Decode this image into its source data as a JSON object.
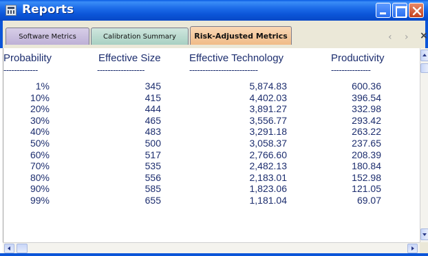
{
  "window": {
    "title": "Reports",
    "colors": {
      "titlebar": "#0b55d8",
      "text": "#1c2d6e",
      "close_button": "#c4401d"
    }
  },
  "tabs": [
    {
      "label": "Software Metrics",
      "active": false,
      "color": "#bdb0d6"
    },
    {
      "label": "Calibration Summary",
      "active": false,
      "color": "#a8d0c2"
    },
    {
      "label": "Risk-Adjusted Metrics",
      "active": true,
      "color": "#f0bb88"
    }
  ],
  "tab_nav": {
    "left_icon": "chevron-left-icon",
    "right_icon": "chevron-right-icon",
    "close_icon": "close-icon"
  },
  "table": {
    "columns": [
      "Probability",
      "Effective Size",
      "Effective Technology",
      "Productivity"
    ],
    "separators": [
      "-------------",
      "------------------",
      "--------------------------",
      "---------------"
    ],
    "rows": [
      [
        "1%",
        "345",
        "5,874.83",
        "600.36"
      ],
      [
        "10%",
        "415",
        "4,402.03",
        "396.54"
      ],
      [
        "20%",
        "444",
        "3,891.27",
        "332.98"
      ],
      [
        "30%",
        "465",
        "3,556.77",
        "293.42"
      ],
      [
        "40%",
        "483",
        "3,291.18",
        "263.22"
      ],
      [
        "50%",
        "500",
        "3,058.37",
        "237.65"
      ],
      [
        "60%",
        "517",
        "2,766.60",
        "208.39"
      ],
      [
        "70%",
        "535",
        "2,482.13",
        "180.84"
      ],
      [
        "80%",
        "556",
        "2,183.01",
        "152.98"
      ],
      [
        "90%",
        "585",
        "1,823.06",
        "121.05"
      ],
      [
        "99%",
        "655",
        "1,181.04",
        "69.07"
      ]
    ]
  }
}
